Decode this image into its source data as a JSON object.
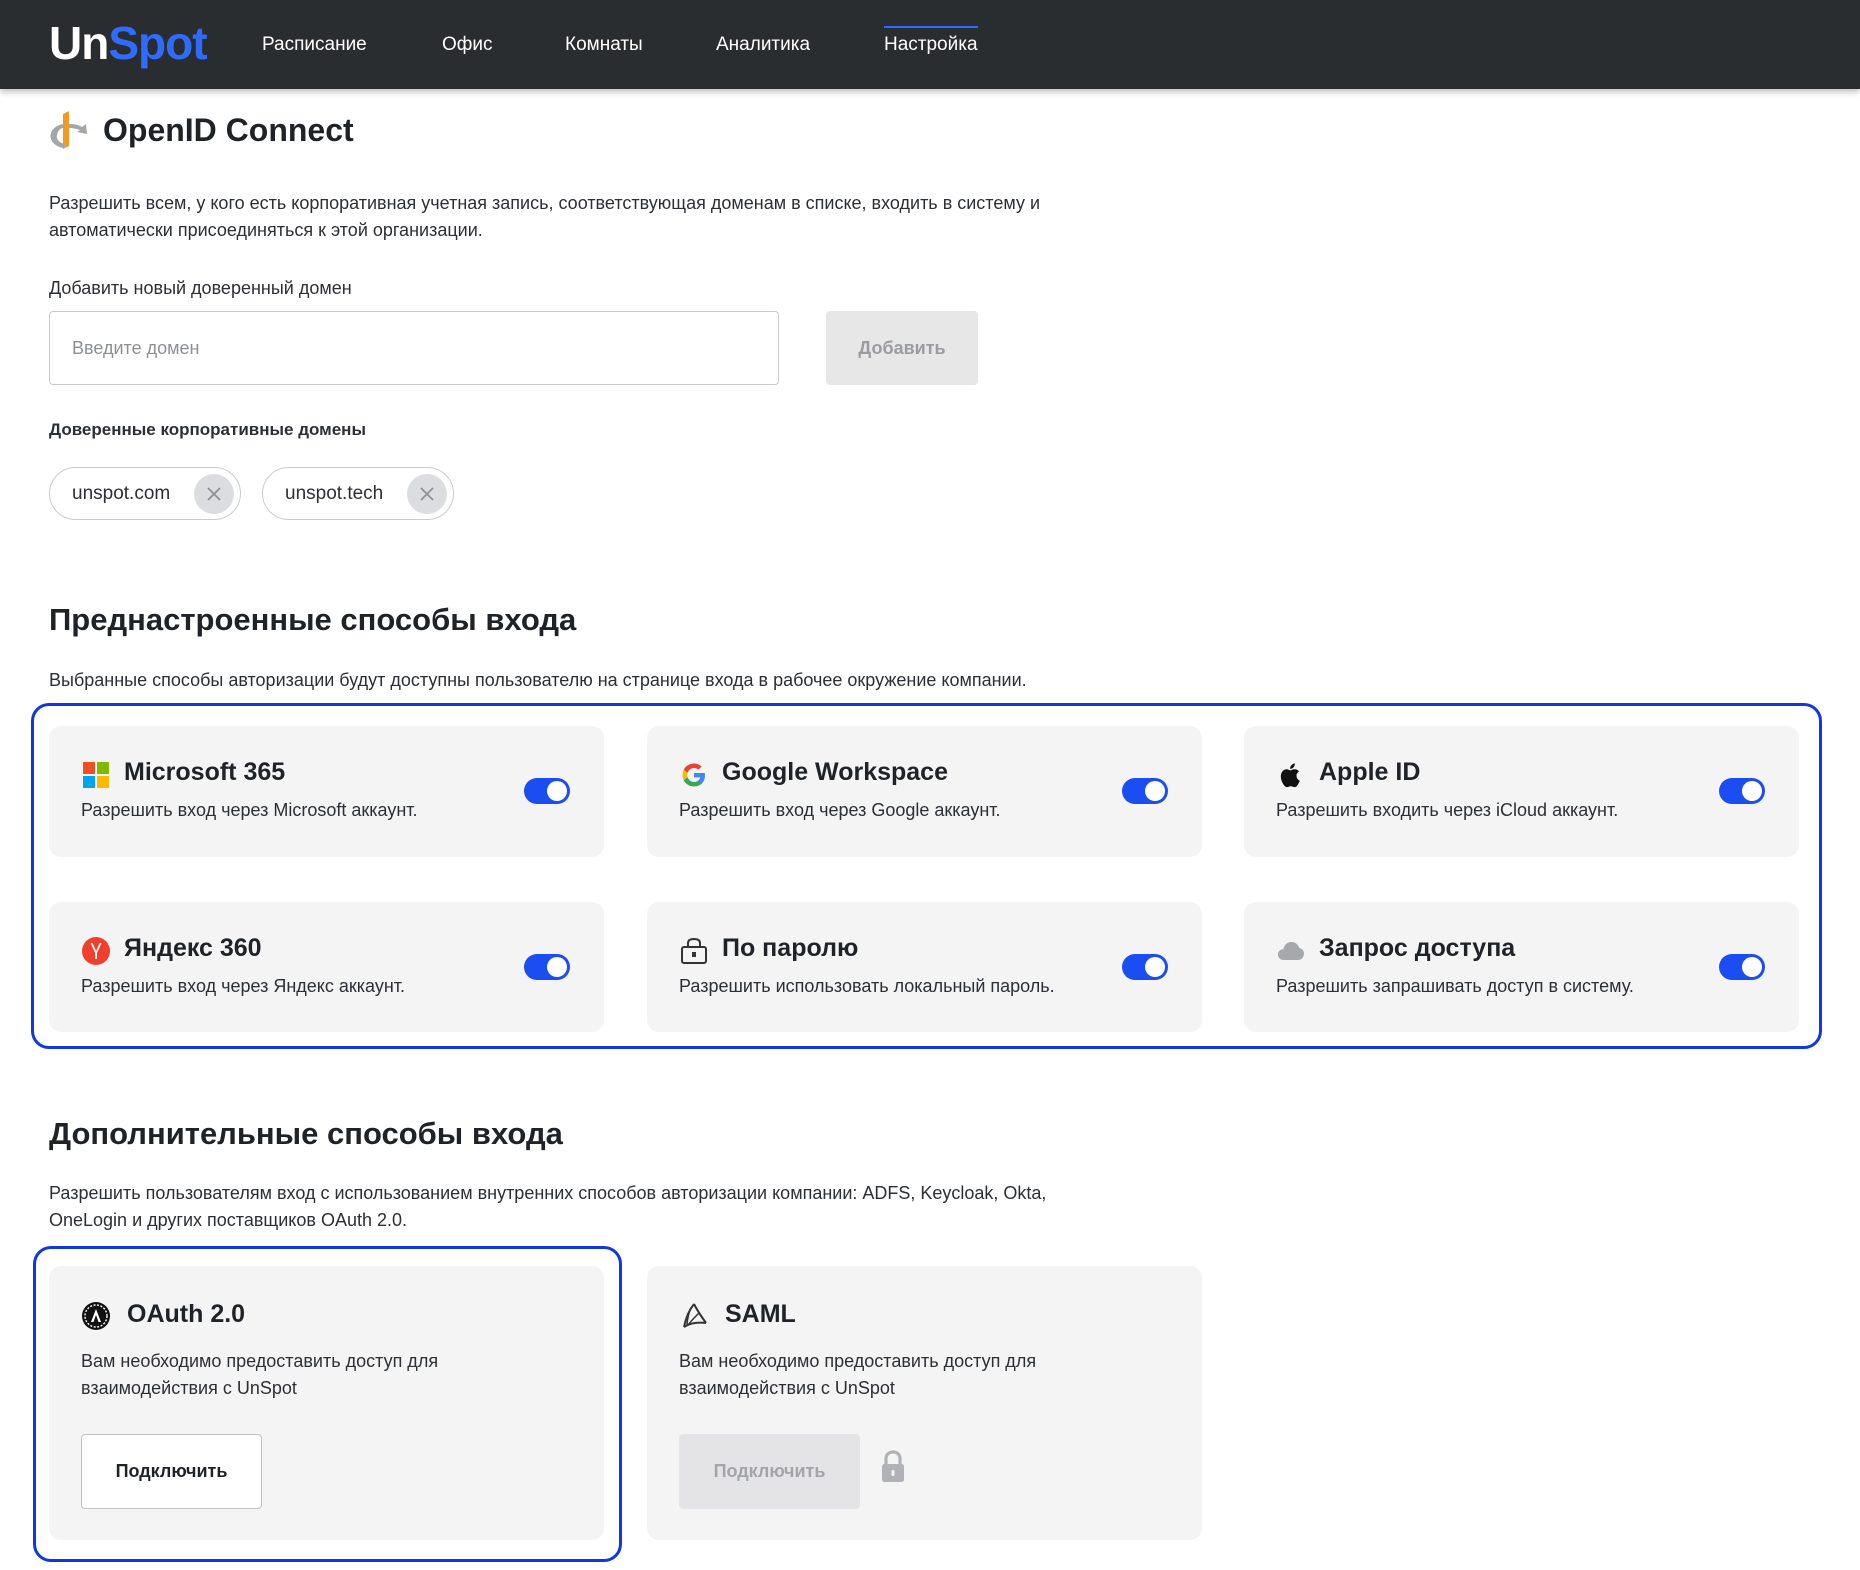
{
  "nav": {
    "logo_un": "Un",
    "logo_spot": "Spot",
    "items": [
      "Расписание",
      "Офис",
      "Комнаты",
      "Аналитика",
      "Настройка"
    ],
    "active": "Настройка"
  },
  "openid": {
    "title": "OpenID Connect",
    "description_line1": "Разрешить всем, у кого есть корпоративная учетная запись, соответствующая доменам в списке, входить в систему и",
    "description_line2": "автоматически присоединяться к этой организации.",
    "add_label": "Добавить новый доверенный домен",
    "input_placeholder": "Введите домен",
    "input_value": "",
    "add_button": "Добавить",
    "trusted_label": "Доверенные корпоративные домены",
    "domains": [
      "unspot.com",
      "unspot.tech"
    ]
  },
  "preset": {
    "title": "Преднастроенные способы входа",
    "description": "Выбранные способы авторизации будут доступны пользователю на странице входа в рабочее окружение компании.",
    "methods": [
      {
        "title": "Microsoft 365",
        "desc": "Разрешить вход через Microsoft аккаунт.",
        "enabled": true,
        "icon": "microsoft-icon"
      },
      {
        "title": "Google Workspace",
        "desc": "Разрешить вход через Google аккаунт.",
        "enabled": true,
        "icon": "google-icon"
      },
      {
        "title": "Apple ID",
        "desc": "Разрешить входить через iCloud аккаунт.",
        "enabled": true,
        "icon": "apple-icon"
      },
      {
        "title": "Яндекс 360",
        "desc": "Разрешить вход через Яндекс аккаунт.",
        "enabled": true,
        "icon": "yandex-icon"
      },
      {
        "title": "По паролю",
        "desc": "Разрешить использовать локальный пароль.",
        "enabled": true,
        "icon": "password-lock-icon"
      },
      {
        "title": "Запрос доступа",
        "desc": "Разрешить запрашивать доступ в систему.",
        "enabled": true,
        "icon": "cloud-icon"
      }
    ]
  },
  "additional": {
    "title": "Дополнительные способы входа",
    "description_line1": "Разрешить пользователям вход с использованием внутренних способов авторизации компании: ADFS, Keycloak, Okta,",
    "description_line2": "OneLogin и других поставщиков OAuth 2.0.",
    "methods": [
      {
        "title": "OAuth 2.0",
        "desc": "Вам необходимо предоставить доступ для взаимодействия с UnSpot",
        "button": "Подключить",
        "button_enabled": true,
        "icon": "oauth-icon"
      },
      {
        "title": "SAML",
        "desc": "Вам необходимо предоставить доступ для взаимодействия с UnSpot",
        "button": "Подключить",
        "button_enabled": false,
        "icon": "saml-icon"
      }
    ]
  },
  "colors": {
    "accent": "#1a4df2",
    "topbar": "#2a2d30",
    "card_bg": "#f4f4f5",
    "highlight_frame": "#1038e0"
  }
}
